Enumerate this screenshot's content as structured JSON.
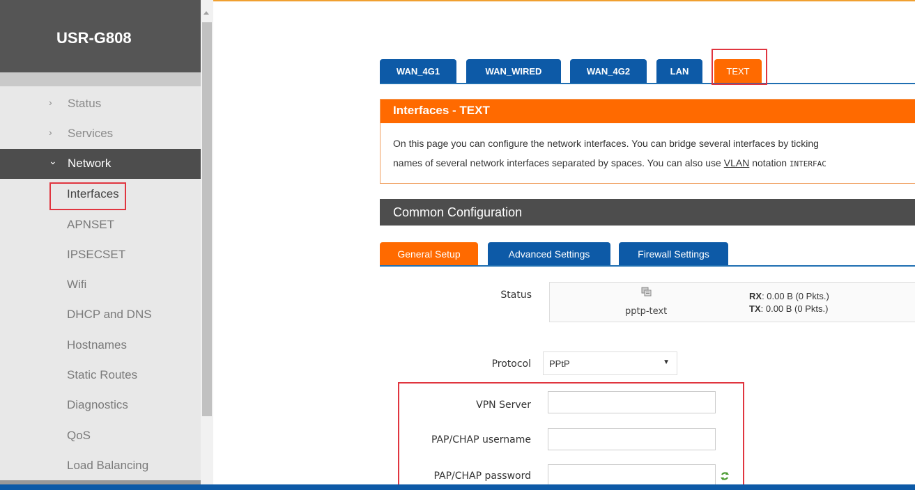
{
  "app": {
    "title": "USR-G808"
  },
  "sidebar": {
    "items": [
      {
        "label": "Status",
        "chevron": "›"
      },
      {
        "label": "Services",
        "chevron": "›"
      },
      {
        "label": "Network",
        "chevron": "⌄"
      }
    ],
    "sub_items": [
      "Interfaces",
      "APNSET",
      "IPSECSET",
      "Wifi",
      "DHCP and DNS",
      "Hostnames",
      "Static Routes",
      "Diagnostics",
      "QoS",
      "Load Balancing"
    ]
  },
  "top_tabs": [
    "WAN_4G1",
    "WAN_WIRED",
    "WAN_4G2",
    "LAN",
    "TEXT"
  ],
  "interfaces": {
    "title": "Interfaces - TEXT",
    "desc_line1": "On this page you can configure the network interfaces. You can bridge several interfaces by ticking",
    "desc_line2_pre": "names of several network interfaces separated by spaces. You can also use ",
    "desc_line2_link": "VLAN",
    "desc_line2_post": " notation ",
    "desc_line2_code": "INTERFAC"
  },
  "common": {
    "title": "Common Configuration",
    "tabs": [
      "General Setup",
      "Advanced Settings",
      "Firewall Settings"
    ]
  },
  "form": {
    "status_label": "Status",
    "device_name": "pptp-text",
    "rx_label": "RX",
    "rx_value": ": 0.00 B (0 Pkts.)",
    "tx_label": "TX",
    "tx_value": ": 0.00 B (0 Pkts.)",
    "protocol_label": "Protocol",
    "protocol_value": "PPtP",
    "vpn_server_label": "VPN Server",
    "vpn_server_value": "",
    "username_label": "PAP/CHAP username",
    "username_value": "",
    "password_label": "PAP/CHAP password",
    "password_value": ""
  },
  "colors": {
    "accent": "#ff6a00",
    "tab_blue": "#0d5aa7",
    "highlight_red": "#e0353f",
    "sidebar_dark": "#555555"
  }
}
